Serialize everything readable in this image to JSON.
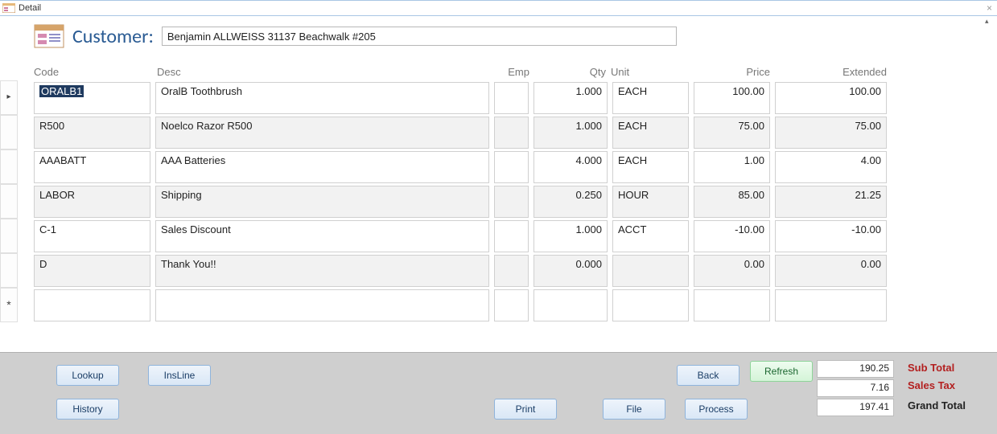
{
  "window": {
    "title": "Detail"
  },
  "header": {
    "customer_label": "Customer:",
    "customer_value": "Benjamin ALLWEISS 31137 Beachwalk #205"
  },
  "columns": {
    "code": "Code",
    "desc": "Desc",
    "emp": "Emp",
    "qty": "Qty",
    "unit": "Unit",
    "price": "Price",
    "extended": "Extended"
  },
  "rows": [
    {
      "code": "ORALB1",
      "desc": "OralB Toothbrush",
      "emp": "",
      "qty": "1.000",
      "unit": "EACH",
      "price": "100.00",
      "ext": "100.00",
      "selected": true
    },
    {
      "code": "R500",
      "desc": "Noelco Razor R500",
      "emp": "",
      "qty": "1.000",
      "unit": "EACH",
      "price": "75.00",
      "ext": "75.00"
    },
    {
      "code": "AAABATT",
      "desc": "AAA Batteries",
      "emp": "",
      "qty": "4.000",
      "unit": "EACH",
      "price": "1.00",
      "ext": "4.00"
    },
    {
      "code": "LABOR",
      "desc": "Shipping",
      "emp": "",
      "qty": "0.250",
      "unit": "HOUR",
      "price": "85.00",
      "ext": "21.25"
    },
    {
      "code": "C-1",
      "desc": "Sales Discount",
      "emp": "",
      "qty": "1.000",
      "unit": "ACCT",
      "price": "-10.00",
      "ext": "-10.00"
    },
    {
      "code": "D",
      "desc": "Thank You!!",
      "emp": "",
      "qty": "0.000",
      "unit": "",
      "price": "0.00",
      "ext": "0.00"
    }
  ],
  "buttons": {
    "lookup": "Lookup",
    "insline": "InsLine",
    "history": "History",
    "print": "Print",
    "file": "File",
    "back": "Back",
    "refresh": "Refresh",
    "process": "Process"
  },
  "totals": {
    "sub_total_label": "Sub Total",
    "sub_total": "190.25",
    "sales_tax_label": "Sales Tax",
    "sales_tax": "7.16",
    "grand_total_label": "Grand Total",
    "grand_total": "197.41"
  }
}
